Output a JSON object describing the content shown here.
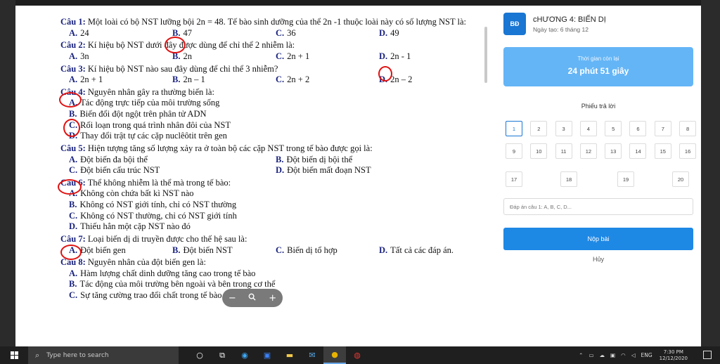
{
  "quiz": {
    "questions": [
      {
        "number": "Câu 1:",
        "text": "Một loài có bộ NST lưỡng bội 2n = 48. Tế bào sinh dưỡng của thể 2n -1 thuộc loài này có số lượng NST là:",
        "layout": "four",
        "options": [
          {
            "letter": "A.",
            "text": "24"
          },
          {
            "letter": "B.",
            "text": "47"
          },
          {
            "letter": "C.",
            "text": "36"
          },
          {
            "letter": "D.",
            "text": "49"
          }
        ]
      },
      {
        "number": "Câu 2:",
        "text": "Kí hiệu bộ NST dưới đây được dùng để chỉ thể 2 nhiễm là:",
        "layout": "four",
        "options": [
          {
            "letter": "A.",
            "text": "3n"
          },
          {
            "letter": "B.",
            "text": "2n"
          },
          {
            "letter": "C.",
            "text": "2n + 1"
          },
          {
            "letter": "D.",
            "text": "2n - 1"
          }
        ]
      },
      {
        "number": "Câu 3:",
        "text": "Kí hiệu bộ NST nào sau đây dùng để chỉ thể 3 nhiễm?",
        "layout": "four",
        "options": [
          {
            "letter": "A.",
            "text": "2n + 1"
          },
          {
            "letter": "B.",
            "text": "2n – 1"
          },
          {
            "letter": "C.",
            "text": "2n + 2"
          },
          {
            "letter": "D.",
            "text": "2n – 2"
          }
        ]
      },
      {
        "number": "Câu 4:",
        "text": "Nguyên nhân gây ra thường biến là:",
        "layout": "one",
        "options": [
          {
            "letter": "A.",
            "text": "Tác động trực tiếp của môi trường sống"
          },
          {
            "letter": "B.",
            "text": "Biến đổi đột ngột trên phân tử ADN"
          },
          {
            "letter": "C.",
            "text": "Rối loạn trong quá trình nhân đôi của NST"
          },
          {
            "letter": "D.",
            "text": "Thay đổi trật tự các cặp nuclêôtit trên gen"
          }
        ]
      },
      {
        "number": "Câu 5:",
        "text": "Hiện tượng tăng số lượng xảy ra ở toàn bộ các cặp NST trong tế bào được gọi là:",
        "layout": "two",
        "options": [
          {
            "letter": "A.",
            "text": "Đột biến đa bội thể"
          },
          {
            "letter": "B.",
            "text": "Đột biến dị bội thể"
          },
          {
            "letter": "C.",
            "text": "Đột biến cấu trúc NST"
          },
          {
            "letter": "D.",
            "text": "Đột biến mất đoạn NST"
          }
        ]
      },
      {
        "number": "Câu 6:",
        "text": "Thể không nhiễm là thể mà trong tế bào:",
        "layout": "one",
        "options": [
          {
            "letter": "A.",
            "text": "Không còn chứa bất kì NST nào"
          },
          {
            "letter": "B.",
            "text": "Không có NST giới tính, chỉ có NST thường"
          },
          {
            "letter": "C.",
            "text": "Không có NST thường, chỉ có NST giới tính"
          },
          {
            "letter": "D.",
            "text": "Thiếu hẳn một cặp NST nào đó"
          }
        ]
      },
      {
        "number": "Câu 7:",
        "text": "Loại biến dị di truyền được cho thế hệ sau là:",
        "layout": "four",
        "options": [
          {
            "letter": "A.",
            "text": "Đột biến gen"
          },
          {
            "letter": "B.",
            "text": "Đột biến NST"
          },
          {
            "letter": "C.",
            "text": "Biến dị tổ hợp"
          },
          {
            "letter": "D.",
            "text": "Tất cả các đáp án."
          }
        ]
      },
      {
        "number": "Câu 8:",
        "text": "Nguyên nhân của đột biến gen là:",
        "layout": "one",
        "options": [
          {
            "letter": "A.",
            "text": "Hàm lượng chất dinh dưỡng tăng cao trong tế bào"
          },
          {
            "letter": "B.",
            "text": "Tác động của môi trường bên ngoài và bên trong cơ thể"
          },
          {
            "letter": "C.",
            "text": "Sự tăng cường trao đổi chất trong tế bào"
          }
        ]
      }
    ]
  },
  "zoom": {
    "minus": "−",
    "zoom_icon": "magnifier-icon",
    "plus": "+"
  },
  "panel": {
    "avatar": "BĐ",
    "title": "cHƯƠNG 4: BIẾN DỊ",
    "created": "Ngày tạo: 6 tháng 12",
    "timer_label": "Thời gian còn lại",
    "timer_value": "24 phút 51 giây",
    "sheet_title": "Phiếu trả lời",
    "cells_row1": [
      "1",
      "2",
      "3",
      "4",
      "5",
      "6",
      "7",
      "8"
    ],
    "cells_row2": [
      "9",
      "10",
      "11",
      "12",
      "13",
      "14",
      "15",
      "16"
    ],
    "cells_row3": [
      "17",
      "18",
      "19",
      "20"
    ],
    "answer_placeholder": "Đáp án câu 1: A, B, C, D...",
    "submit_label": "Nộp bài",
    "cancel_label": "Hủy",
    "accent_color": "#1e88e5",
    "timer_color": "#64b5f6"
  },
  "taskbar": {
    "search_placeholder": "Type here to search",
    "language": "ENG",
    "time": "7:30 PM",
    "date": "12/12/2020"
  }
}
